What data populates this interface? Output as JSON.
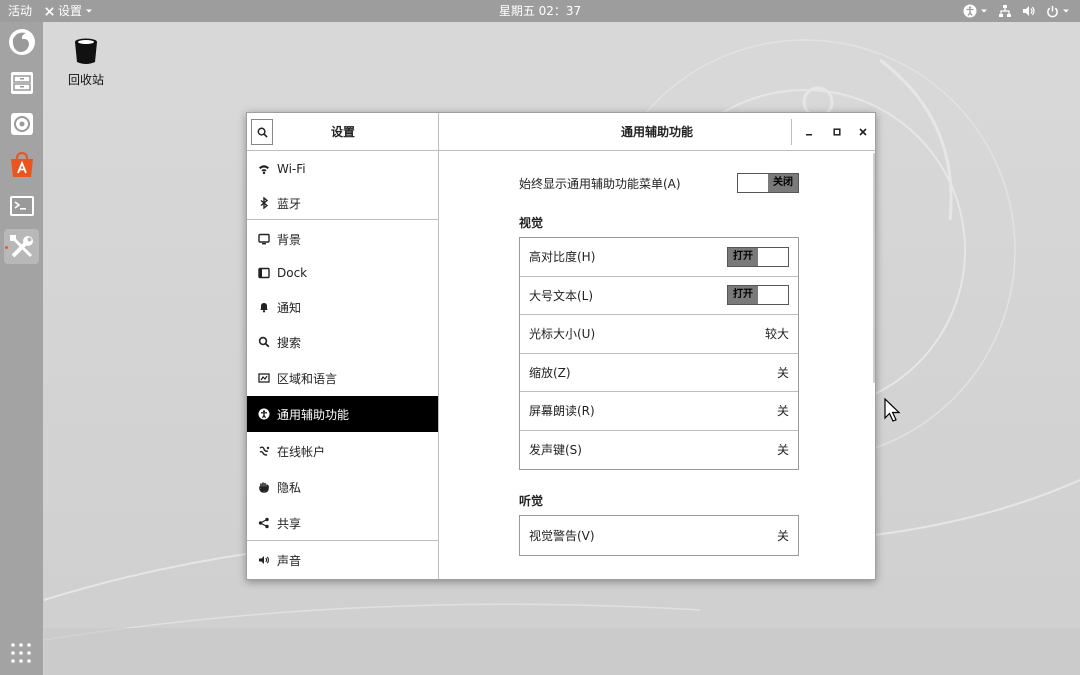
{
  "topbar": {
    "activities": "活动",
    "app_menu": "设置",
    "clock": "星期五 02：37"
  },
  "desktop": {
    "trash_label": "回收站"
  },
  "dock": {
    "items": [
      "firefox-icon",
      "files-icon",
      "rhythmbox-icon",
      "software-icon",
      "terminal-icon",
      "settings-icon"
    ]
  },
  "window": {
    "sidebar_title": "设置",
    "main_title": "通用辅助功能",
    "minimize": "_",
    "maximize": "□",
    "close": "×"
  },
  "sidebar": {
    "items": [
      {
        "label": "Wi-Fi",
        "icon": "wifi-icon"
      },
      {
        "label": "蓝牙",
        "icon": "bluetooth-icon"
      },
      {
        "label": "背景",
        "icon": "background-icon"
      },
      {
        "label": "Dock",
        "icon": "dock-icon"
      },
      {
        "label": "通知",
        "icon": "bell-icon"
      },
      {
        "label": "搜索",
        "icon": "search-icon"
      },
      {
        "label": "区域和语言",
        "icon": "flag-icon"
      },
      {
        "label": "通用辅助功能",
        "icon": "accessibility-icon"
      },
      {
        "label": "在线帐户",
        "icon": "online-accounts-icon"
      },
      {
        "label": "隐私",
        "icon": "hand-icon"
      },
      {
        "label": "共享",
        "icon": "share-icon"
      },
      {
        "label": "声音",
        "icon": "speaker-icon"
      }
    ],
    "selected": "通用辅助功能"
  },
  "content": {
    "always_show_label": "始终显示通用辅助功能菜单(A)",
    "always_show_state": "关闭",
    "vision_title": "视觉",
    "vision": [
      {
        "label": "高对比度(H)",
        "toggle": "打开"
      },
      {
        "label": "大号文本(L)",
        "toggle": "打开"
      },
      {
        "label": "光标大小(U)",
        "value": "较大"
      },
      {
        "label": "缩放(Z)",
        "value": "关"
      },
      {
        "label": "屏幕朗读(R)",
        "value": "关"
      },
      {
        "label": "发声键(S)",
        "value": "关"
      }
    ],
    "hearing_title": "听觉",
    "hearing": [
      {
        "label": "视觉警告(V)",
        "value": "关"
      }
    ]
  },
  "colors": {
    "topbar": "#9d9d9d",
    "dock": "#a3a3a3",
    "selected": "#000000",
    "software_orange": "#e95420"
  }
}
